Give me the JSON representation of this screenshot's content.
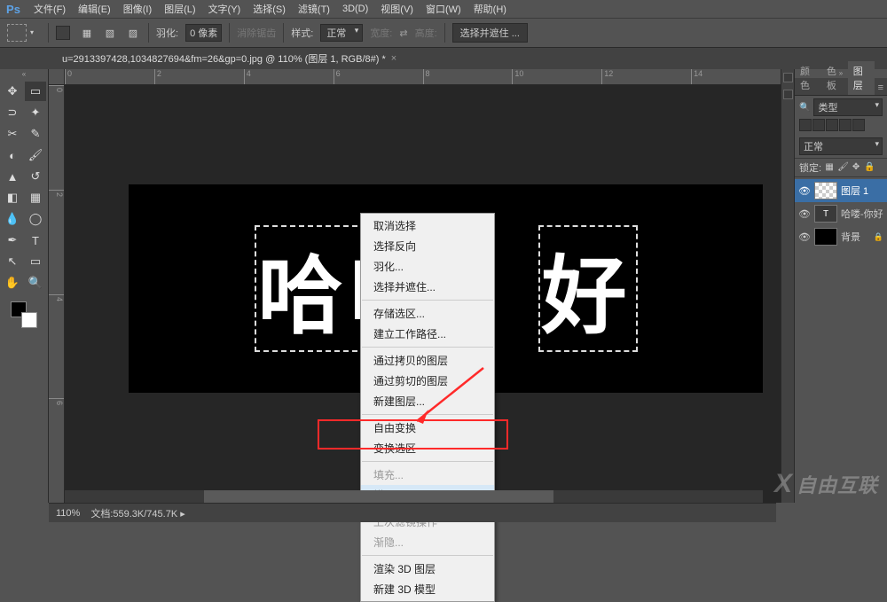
{
  "menubar": {
    "items": [
      "文件(F)",
      "编辑(E)",
      "图像(I)",
      "图层(L)",
      "文字(Y)",
      "选择(S)",
      "滤镜(T)",
      "3D(D)",
      "视图(V)",
      "窗口(W)",
      "帮助(H)"
    ]
  },
  "optbar": {
    "feather_label": "羽化:",
    "feather_value": "0 像素",
    "antialias": "消除锯齿",
    "style_label": "样式:",
    "style_value": "正常",
    "width_label": "宽度:",
    "swap": "⇄",
    "height_label": "高度:",
    "refine": "选择并遮住 ..."
  },
  "tab": {
    "title": "u=2913397428,1034827694&fm=26&gp=0.jpg @ 110% (图层 1, RGB/8#) *"
  },
  "canvas": {
    "text_left": "哈喽",
    "text_right": "好"
  },
  "ruler_h": [
    "0",
    "2",
    "4",
    "6",
    "8",
    "10",
    "12",
    "14"
  ],
  "ruler_v": [
    "0",
    "2",
    "4",
    "6"
  ],
  "context_menu": {
    "g1": [
      "取消选择",
      "选择反向",
      "羽化...",
      "选择并遮住..."
    ],
    "g2": [
      "存储选区...",
      "建立工作路径..."
    ],
    "g3": [
      "通过拷贝的图层",
      "通过剪切的图层",
      "新建图层..."
    ],
    "g4": [
      "自由变换",
      "变换选区"
    ],
    "g5": [
      {
        "t": "填充...",
        "d": true
      },
      {
        "t": "描边...",
        "d": false,
        "hover": true
      }
    ],
    "g6": [
      {
        "t": "上次滤镜操作",
        "d": true
      },
      {
        "t": "渐隐...",
        "d": true
      }
    ],
    "g7": [
      "渲染 3D 图层",
      "新建 3D 模型"
    ]
  },
  "panels": {
    "tabs": [
      "颜色",
      "色板",
      "图层"
    ],
    "kind_label": "类型",
    "blend": "正常",
    "lock_label": "锁定:",
    "layers": [
      {
        "name": "图层 1",
        "thumb": "checker",
        "active": true
      },
      {
        "name": "哈喽-你好",
        "thumb": "T"
      },
      {
        "name": "背景",
        "thumb": "black",
        "locked": true
      }
    ]
  },
  "status": {
    "zoom": "110%",
    "doc_label": "文档:",
    "doc": "559.3K/745.7K"
  },
  "watermark": "自由互联"
}
